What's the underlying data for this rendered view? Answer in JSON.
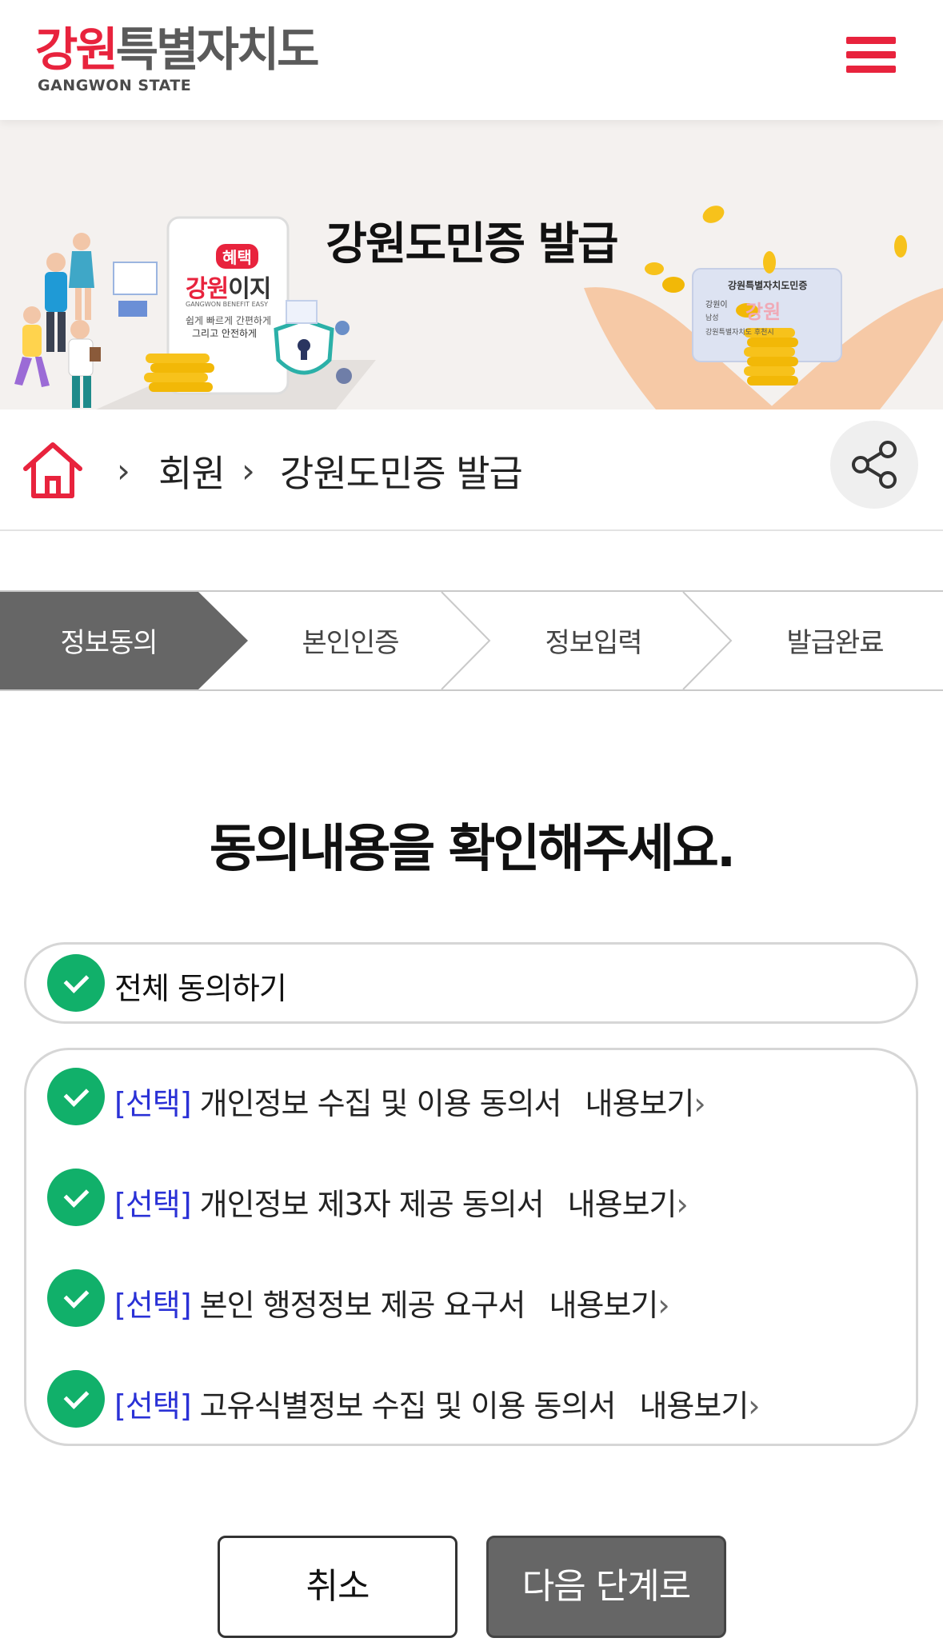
{
  "header": {
    "logo_main_red": "강원",
    "logo_main_rest": "특별자치도",
    "logo_sub": "GANGWON STATE"
  },
  "banner": {
    "title": "강원도민증 발급",
    "app_badge": "혜택",
    "app_name_red": "강원",
    "app_name_rest": "이지",
    "app_sub": "GANGWON BENEFIT EASY",
    "app_slogan_1": "쉽게 빠르게 간편하게",
    "app_slogan_2": "그리고 안전하게",
    "card_title": "강원특별자치도민증",
    "card_name": "강원이",
    "card_gender": "남성",
    "card_logo": "강원",
    "card_footer": "강원특별자치도 후천시"
  },
  "breadcrumb": {
    "items": [
      "회원",
      "강원도민증 발급"
    ]
  },
  "steps": [
    {
      "label": "정보동의",
      "active": true
    },
    {
      "label": "본인인증",
      "active": false
    },
    {
      "label": "정보입력",
      "active": false
    },
    {
      "label": "발급완료",
      "active": false
    }
  ],
  "title": "동의내용을 확인해주세요.",
  "agree_all": {
    "label": "전체 동의하기",
    "checked": true
  },
  "agreements": [
    {
      "tag": "[선택]",
      "text": "개인정보 수집 및 이용 동의서",
      "link": "내용보기",
      "checked": true
    },
    {
      "tag": "[선택]",
      "text": "개인정보 제3자 제공 동의서",
      "link": "내용보기",
      "checked": true
    },
    {
      "tag": "[선택]",
      "text": "본인 행정정보 제공 요구서",
      "link": "내용보기",
      "checked": true
    },
    {
      "tag": "[선택]",
      "text": "고유식별정보 수집 및 이용 동의서",
      "link": "내용보기",
      "checked": true
    }
  ],
  "buttons": {
    "cancel": "취소",
    "next": "다음 단계로"
  },
  "colors": {
    "brand_red": "#e8233d",
    "check_green": "#11b06a",
    "tag_blue": "#2a31d6",
    "active_step": "#666666"
  }
}
